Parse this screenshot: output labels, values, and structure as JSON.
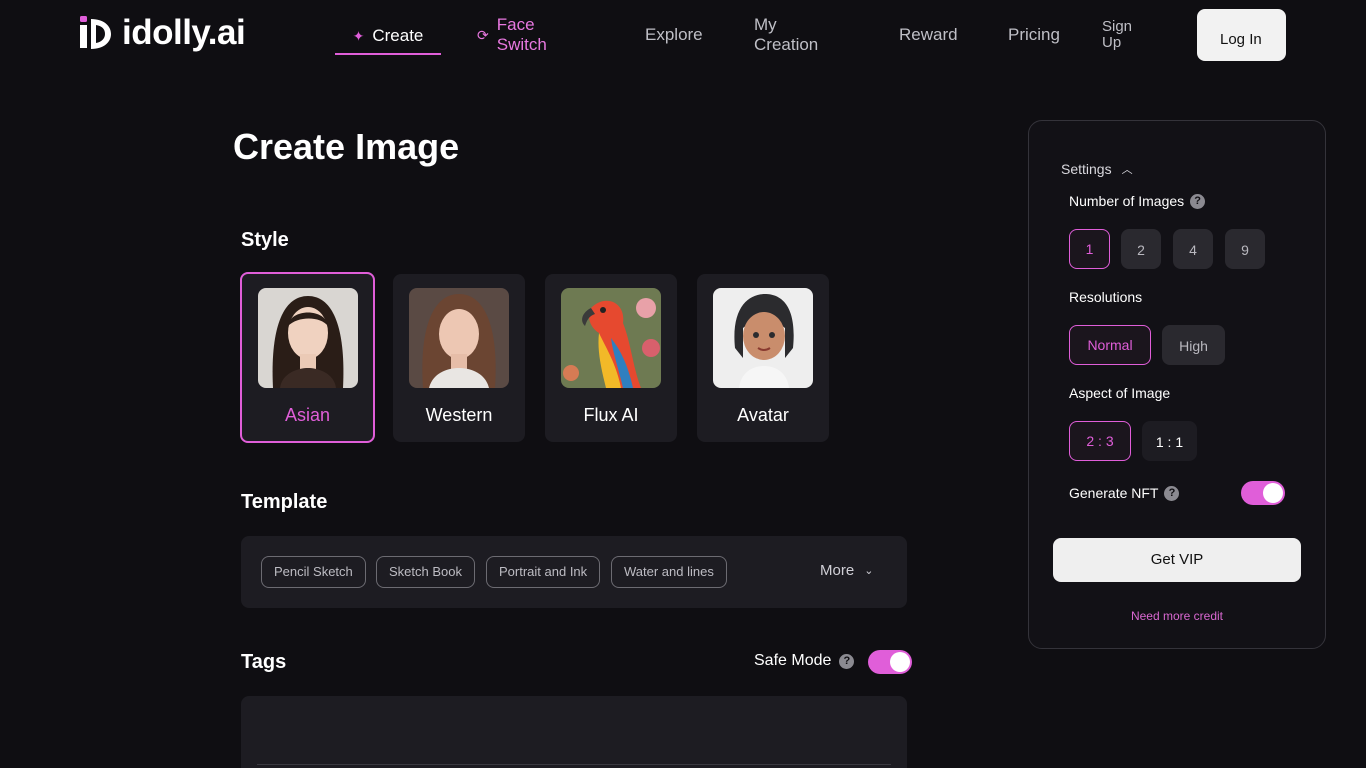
{
  "brand": {
    "name": "idolly.ai",
    "accent": "#e05ed9"
  },
  "nav": {
    "create": "Create",
    "face_switch": "Face Switch",
    "explore": "Explore",
    "my_creation": "My Creation",
    "reward": "Reward",
    "pricing": "Pricing",
    "sign_up": "Sign Up",
    "log_in": "Log In"
  },
  "main": {
    "title": "Create Image",
    "style": {
      "heading": "Style",
      "items": [
        {
          "label": "Asian",
          "selected": true
        },
        {
          "label": "Western",
          "selected": false
        },
        {
          "label": "Flux AI",
          "selected": false
        },
        {
          "label": "Avatar",
          "selected": false
        }
      ]
    },
    "template": {
      "heading": "Template",
      "chips": [
        "Pencil Sketch",
        "Sketch Book",
        "Portrait and Ink",
        "Water and lines"
      ],
      "more": "More"
    },
    "tags": {
      "heading": "Tags",
      "safe_mode": "Safe Mode",
      "safe_mode_on": true
    }
  },
  "settings": {
    "heading": "Settings",
    "num_images": {
      "label": "Number of Images",
      "options": [
        "1",
        "2",
        "4",
        "9"
      ],
      "selected": "1"
    },
    "resolutions": {
      "label": "Resolutions",
      "options": [
        "Normal",
        "High"
      ],
      "selected": "Normal"
    },
    "aspect": {
      "label": "Aspect of Image",
      "options": [
        "2 : 3",
        "1 : 1"
      ],
      "selected": "2 : 3"
    },
    "nft": {
      "label": "Generate NFT",
      "on": true
    },
    "vip_button": "Get VIP",
    "more_credit": "Need more credit"
  },
  "icons": {
    "help": "?",
    "create": "sparkle-icon",
    "face_switch": "refresh-icon"
  }
}
